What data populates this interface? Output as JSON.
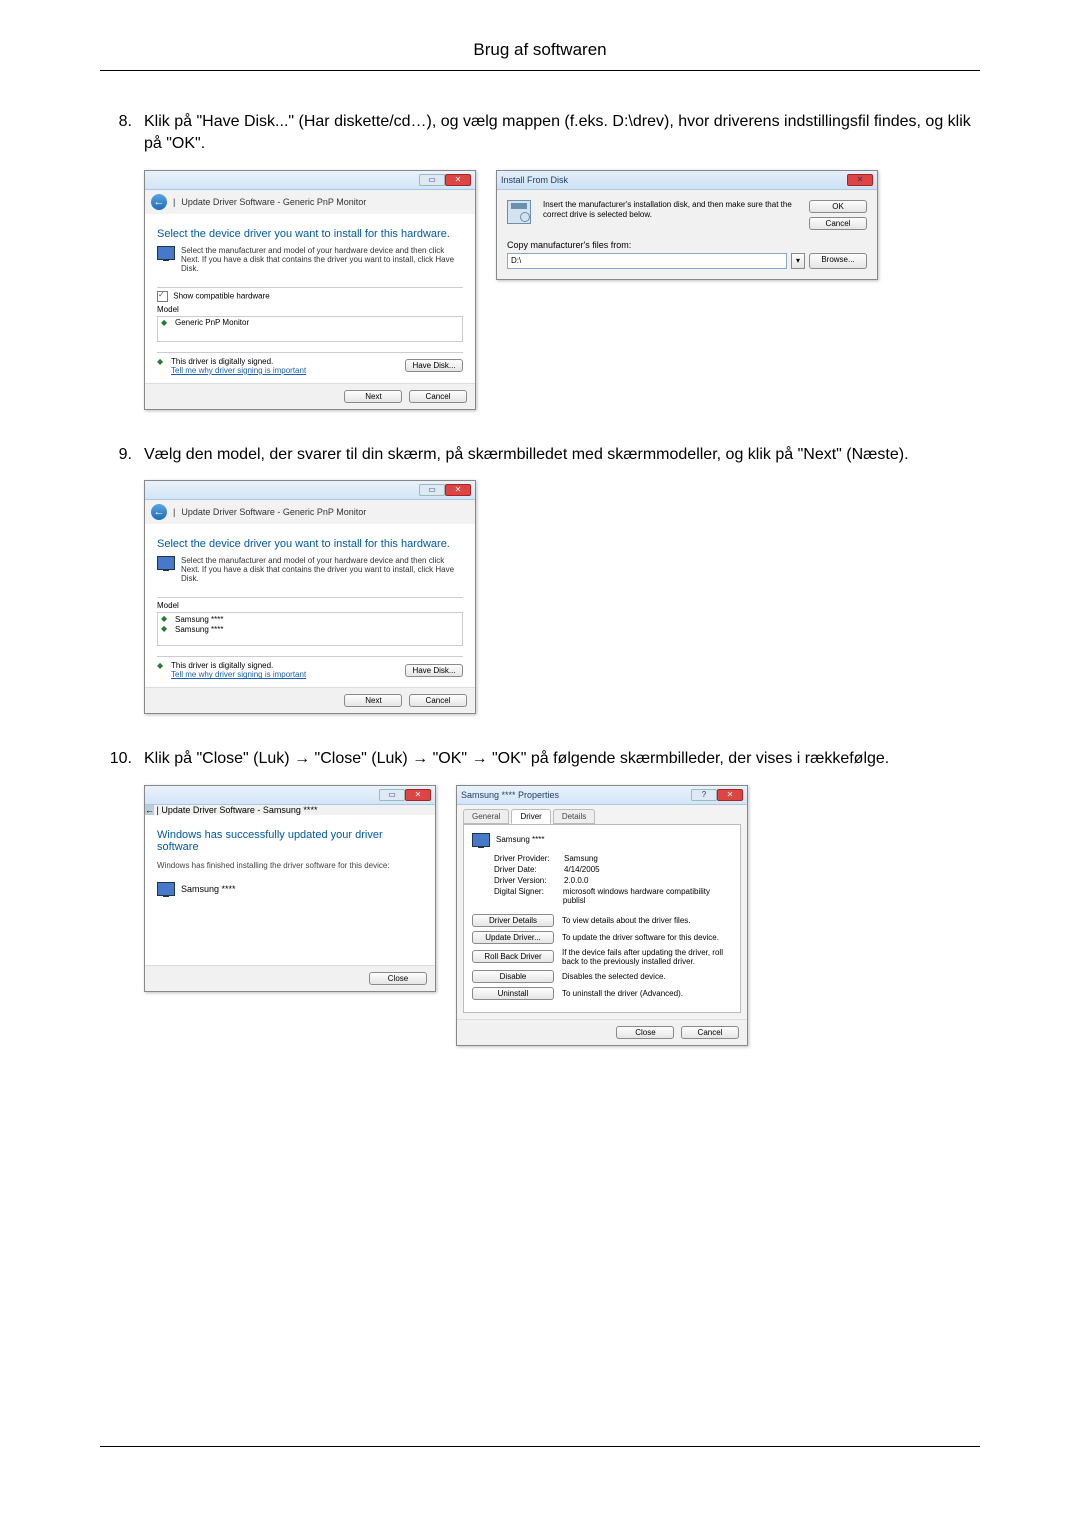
{
  "header": {
    "title": "Brug af softwaren"
  },
  "steps": {
    "s8": {
      "num": "8.",
      "text": "Klik på \"Have Disk...\" (Har diskette/cd…), og vælg mappen (f.eks. D:\\drev), hvor driverens indstillingsfil findes, og klik på \"OK\"."
    },
    "s9": {
      "num": "9.",
      "text": "Vælg den model, der svarer til din skærm, på skærmbilledet med skærmmodeller, og klik på \"Next\" (Næste)."
    },
    "s10": {
      "num": "10.",
      "text": "Klik på \"Close\" (Luk) → \"Close\" (Luk) → \"OK\" → \"OK\" på følgende skærmbilleder, der vises i rækkefølge."
    }
  },
  "wiz8": {
    "crumb": "Update Driver Software - Generic PnP Monitor",
    "heading": "Select the device driver you want to install for this hardware.",
    "desc": "Select the manufacturer and model of your hardware device and then click Next. If you have a disk that contains the driver you want to install, click Have Disk.",
    "show_compat": "Show compatible hardware",
    "model_label": "Model",
    "model_item": "Generic PnP Monitor",
    "signed": "This driver is digitally signed.",
    "tell_me": "Tell me why driver signing is important",
    "have_disk": "Have Disk...",
    "next": "Next",
    "cancel": "Cancel"
  },
  "disk": {
    "title": "Install From Disk",
    "msg": "Insert the manufacturer's installation disk, and then make sure that the correct drive is selected below.",
    "ok": "OK",
    "cancel": "Cancel",
    "copy_from": "Copy manufacturer's files from:",
    "path": "D:\\",
    "browse": "Browse..."
  },
  "wiz9": {
    "crumb": "Update Driver Software - Generic PnP Monitor",
    "heading": "Select the device driver you want to install for this hardware.",
    "desc": "Select the manufacturer and model of your hardware device and then click Next. If you have a disk that contains the driver you want to install, click Have Disk.",
    "model_label": "Model",
    "model_item1": "Samsung ****",
    "model_item2": "Samsung ****",
    "signed": "This driver is digitally signed.",
    "tell_me": "Tell me why driver signing is important",
    "have_disk": "Have Disk...",
    "next": "Next",
    "cancel": "Cancel"
  },
  "success": {
    "crumb": "Update Driver Software - Samsung ****",
    "title": "Windows has successfully updated your driver software",
    "sub": "Windows has finished installing the driver software for this device:",
    "item": "Samsung ****",
    "close": "Close"
  },
  "props": {
    "title": "Samsung **** Properties",
    "tab_general": "General",
    "tab_driver": "Driver",
    "tab_details": "Details",
    "device": "Samsung ****",
    "provider_k": "Driver Provider:",
    "provider_v": "Samsung",
    "date_k": "Driver Date:",
    "date_v": "4/14/2005",
    "ver_k": "Driver Version:",
    "ver_v": "2.0.0.0",
    "signer_k": "Digital Signer:",
    "signer_v": "microsoft windows hardware compatibility publisl",
    "btn_details": "Driver Details",
    "btn_details_d": "To view details about the driver files.",
    "btn_update": "Update Driver...",
    "btn_update_d": "To update the driver software for this device.",
    "btn_rollback": "Roll Back Driver",
    "btn_rollback_d": "If the device fails after updating the driver, roll back to the previously installed driver.",
    "btn_disable": "Disable",
    "btn_disable_d": "Disables the selected device.",
    "btn_uninstall": "Uninstall",
    "btn_uninstall_d": "To uninstall the driver (Advanced).",
    "close": "Close",
    "cancel": "Cancel"
  }
}
